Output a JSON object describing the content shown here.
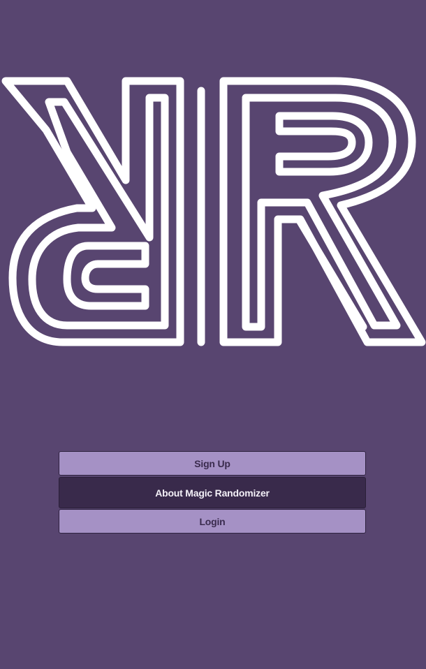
{
  "logo": {
    "icon": "magic-randomizer-rr-logo",
    "color": "#ffffff"
  },
  "buttons": {
    "signup_label": "Sign Up",
    "about_label": "About Magic Randomizer",
    "login_label": "Login"
  },
  "colors": {
    "background": "#584570",
    "button_light": "#a591c5",
    "button_dark": "#392a4b"
  }
}
